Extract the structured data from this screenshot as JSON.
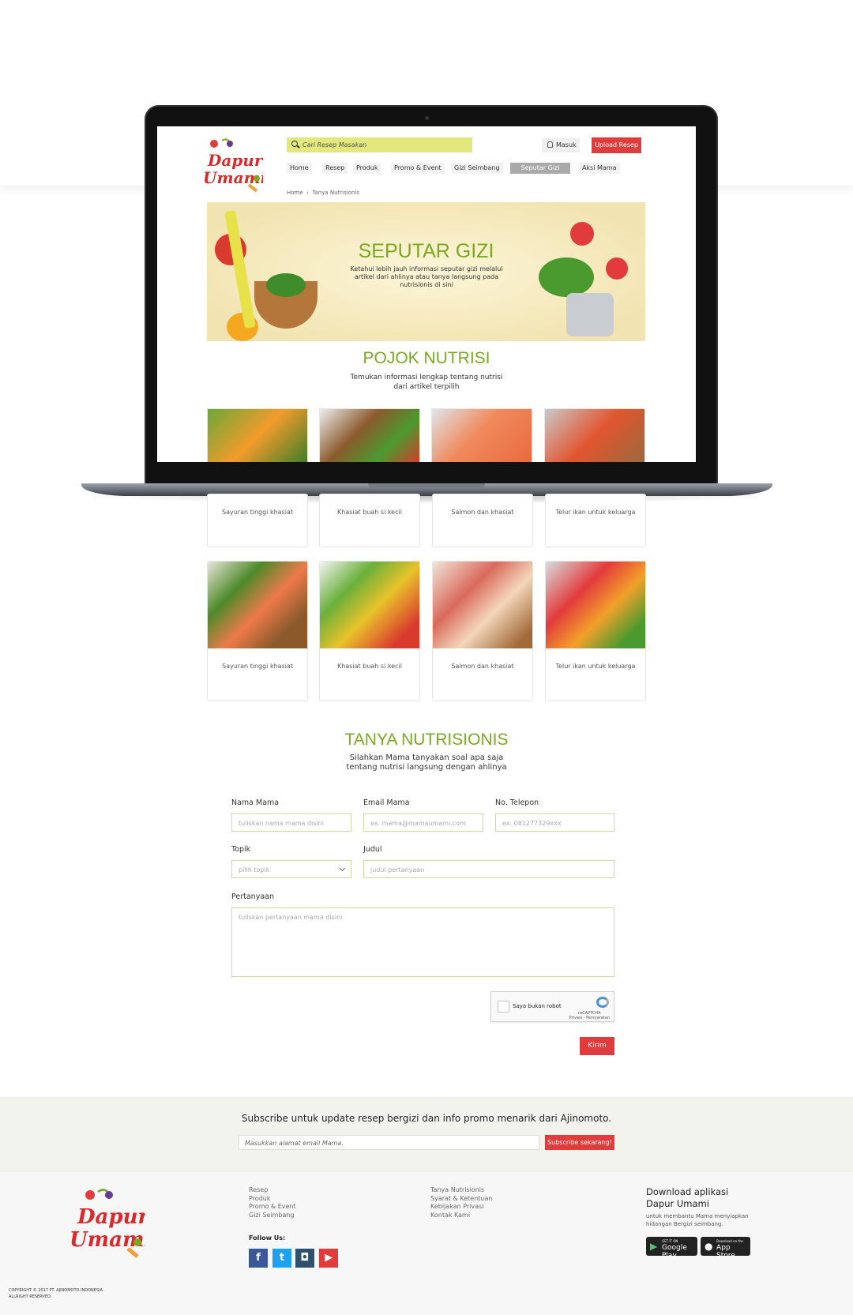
{
  "header": {
    "search_placeholder": "Cari Resep Masakan",
    "login_label": "Masuk",
    "upload_label": "Upload Resep",
    "nav": [
      "Home",
      "Resep",
      "Produk",
      "Promo & Event",
      "Gizi Seimbang",
      "Seputar Gizi",
      "Aksi Mama"
    ],
    "active_nav": "Seputar Gizi"
  },
  "breadcrumb": {
    "home": "Home",
    "separator": "›",
    "current": "Tanya Nutrisionis"
  },
  "logo": {
    "line1": "Dapur",
    "line2": "Umami"
  },
  "hero": {
    "title": "SEPUTAR GIZI",
    "subtitle": "Ketahui lebih jauh informasi seputar gizi melalui artikel dari ahlinya atau tanya langsung pada nutrisionis di sini"
  },
  "pojok": {
    "title": "POJOK NUTRISI",
    "subtitle_line1": "Temukan informasi lengkap tentang nutrisi",
    "subtitle_line2": "dari artikel terpilih",
    "cards": [
      {
        "caption": "Sayuran tinggi khasiat"
      },
      {
        "caption": "Khasiat buah si kecil"
      },
      {
        "caption": "Salmon dan khasiat"
      },
      {
        "caption": "Telur ikan untuk keluarga"
      },
      {
        "caption": "Sayuran tinggi khasiat"
      },
      {
        "caption": "Khasiat buah si kecil"
      },
      {
        "caption": "Salmon dan khasiat"
      },
      {
        "caption": "Telur ikan untuk keluarga"
      }
    ]
  },
  "tanya": {
    "title": "TANYA NUTRISIONIS",
    "subtitle_line1": "Silahkan Mama tanyakan soal apa saja",
    "subtitle_line2": "tentang nutrisi langsung dengan ahlinya",
    "form": {
      "name_label": "Nama Mama",
      "name_placeholder": "tuliskan nama mama disini",
      "email_label": "Email Mama",
      "email_placeholder": "ex. mama@mamaumami.com",
      "phone_label": "No. Telepon",
      "phone_placeholder": "ex. 081277329xxx",
      "topic_label": "Topik",
      "topic_value": "pilih topik",
      "title_label": "Judul",
      "title_placeholder": "judul pertanyaan",
      "question_label": "Pertanyaan",
      "question_placeholder": "tuliskan pertanyaan mama disini",
      "captcha_label": "Saya bukan robot",
      "captcha_brand": "reCAPTCHA",
      "captcha_links": "Privasi - Persyaratan",
      "submit_label": "Kirim"
    }
  },
  "subscribe": {
    "title": "Subscribe untuk update resep bergizi dan info promo menarik dari Ajinomoto.",
    "placeholder": "Masukkan alamat email Mama.",
    "button": "Subscribe sekarang!"
  },
  "footer": {
    "links_col1": [
      "Resep",
      "Produk",
      "Promo & Event",
      "Gizi Seimbang"
    ],
    "links_col2": [
      "Tanya Nutrisionis",
      "Syarat & Ketentuan",
      "Kebijakan Privasi",
      "Kontak Kami"
    ],
    "follow_label": "Follow Us:",
    "social": [
      {
        "name": "facebook",
        "glyph": "f",
        "color": "#3b5998"
      },
      {
        "name": "twitter",
        "glyph": "t",
        "color": "#1da1f2"
      },
      {
        "name": "instagram",
        "glyph": "◘",
        "color": "#2f4f6f"
      },
      {
        "name": "youtube",
        "glyph": "▶",
        "color": "#e23b3b"
      }
    ],
    "download_title_line1": "Download aplikasi",
    "download_title_line2": "Dapur Umami",
    "download_sub": "untuk membantu Mama menyiapkan hidangan Bergizi seimbang.",
    "google_small": "GET IT ON",
    "google_big": "Google Play",
    "apple_small": "Download on the",
    "apple_big": "App Store",
    "copyright_line1": "COPYRIGHT © 2017 PT. AJINOMOTO INDONESIA.",
    "copyright_line2": "ALLRIGHT RESERVED."
  },
  "colors": {
    "accent_green": "#7aa821",
    "brand_red": "#e23b3b",
    "search_yellow": "#e3e87d"
  }
}
